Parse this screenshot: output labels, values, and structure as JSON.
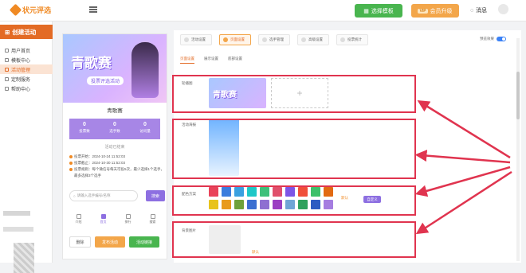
{
  "header": {
    "logo_text": "状元评选",
    "template_button": "选择模板",
    "vip_tag": "VIP",
    "vip_button": "会员升级",
    "message_label": "消息"
  },
  "sidebar": {
    "create_button": "创建活动",
    "items": [
      {
        "label": "用户首页",
        "active": false
      },
      {
        "label": "模板中心",
        "active": false
      },
      {
        "label": "活动管理",
        "active": true
      },
      {
        "label": "定制服务",
        "active": false
      },
      {
        "label": "帮助中心",
        "active": false
      }
    ]
  },
  "phone": {
    "banner_title": "青歌赛",
    "banner_subtitle": "投票评选活动",
    "activity_name": "青歌赛",
    "stats": [
      {
        "value": "0",
        "label": "投票数"
      },
      {
        "value": "0",
        "label": "选手数"
      },
      {
        "value": "0",
        "label": "访问量"
      }
    ],
    "status": "活动已结束",
    "info": [
      "投票开始：2024-10-24 11:52:03",
      "投票截止：2024-10-30 11:52:03",
      "投票规则：每个微信号每天可投5次，最少选择1个选手，最多选择3个选手"
    ],
    "search_placeholder": "请输入选手编号/名称",
    "search_button": "搜索",
    "tabs": [
      {
        "label": "介绍",
        "active": false
      },
      {
        "label": "首页",
        "active": true
      },
      {
        "label": "排行",
        "active": false
      },
      {
        "label": "搜索",
        "active": false
      }
    ],
    "delete_button": "删除",
    "publish_button": "发布活动",
    "link_button": "活动链接"
  },
  "main": {
    "steps": [
      {
        "label": "活动设置",
        "active": false
      },
      {
        "label": "页面设置",
        "active": true
      },
      {
        "label": "选手管理",
        "active": false
      },
      {
        "label": "高级设置",
        "active": false
      },
      {
        "label": "投票统计",
        "active": false
      }
    ],
    "preview_label": "预览效果",
    "subtabs": [
      {
        "label": "页面设置",
        "active": true
      },
      {
        "label": "展示设置",
        "active": false
      },
      {
        "label": "底部设置",
        "active": false
      }
    ],
    "cover": {
      "label": "轮播图",
      "image_title": "青歌赛",
      "add_symbol": "+"
    },
    "poster": {
      "label": "活动海报"
    },
    "theme": {
      "label": "配色方案",
      "row1": [
        "#e9435a",
        "#3b7ddd",
        "#3aa0e0",
        "#1ec7c7",
        "#3ec07a",
        "#e0506c",
        "#7d55e6",
        "#f04f3a",
        "#3ec06a",
        "#e26a12"
      ],
      "row2": [
        "#e8c31c",
        "#e89a1c",
        "#6ea23a",
        "#3b6fd1",
        "#8e6fd1",
        "#9b3fc2",
        "#6fa5d6",
        "#2fa15c",
        "#2c5bc2",
        "#a57de0"
      ],
      "default_label": "默认",
      "custom_button": "自定义"
    },
    "background": {
      "label": "背景图片",
      "default_label": "默认"
    }
  }
}
